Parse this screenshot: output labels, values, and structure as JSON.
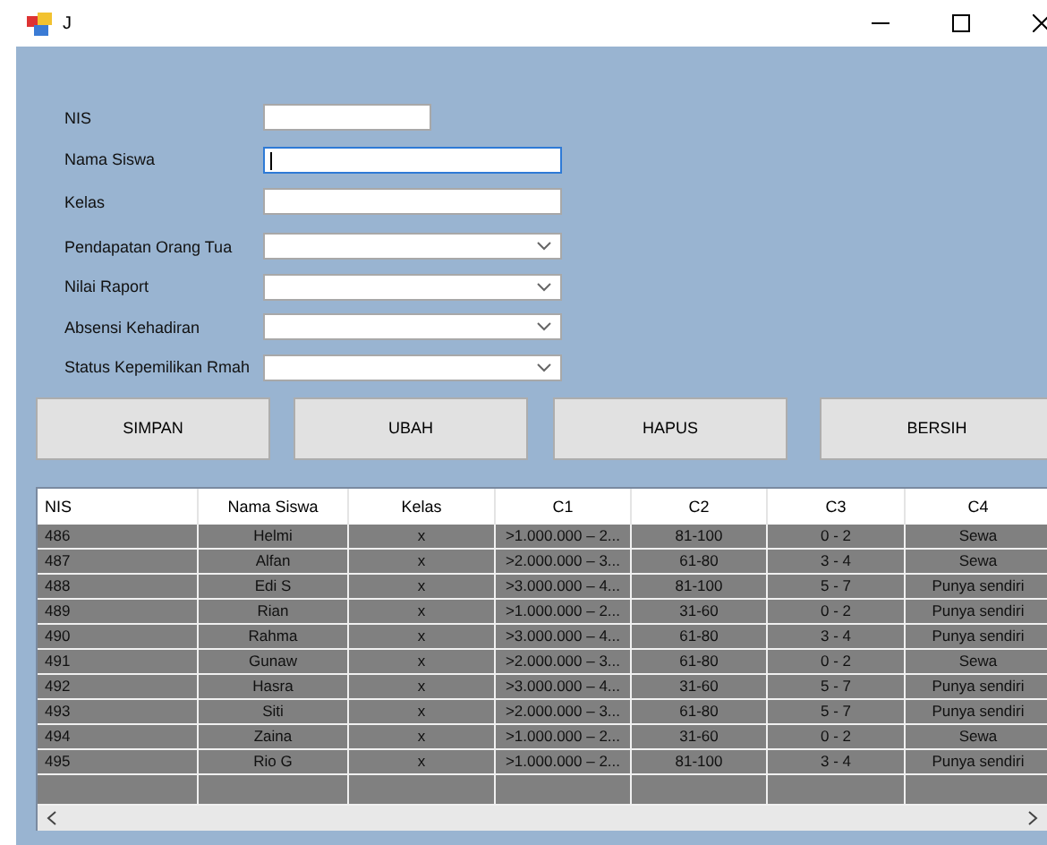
{
  "window": {
    "title": "J"
  },
  "fields": [
    {
      "label": "NIS",
      "kind": "text",
      "focused": false
    },
    {
      "label": "Nama Siswa",
      "kind": "text",
      "focused": true
    },
    {
      "label": "Kelas",
      "kind": "text",
      "focused": false
    },
    {
      "label": "Pendapatan Orang Tua",
      "kind": "combo",
      "focused": false
    },
    {
      "label": "Nilai Raport",
      "kind": "combo",
      "focused": false
    },
    {
      "label": "Absensi Kehadiran",
      "kind": "combo",
      "focused": false
    },
    {
      "label": "Status Kepemilikan Rmah",
      "kind": "combo",
      "focused": false
    }
  ],
  "buttons": [
    "SIMPAN",
    "UBAH",
    "HAPUS",
    "BERSIH"
  ],
  "table": {
    "columns": [
      "NIS",
      "Nama Siswa",
      "Kelas",
      "C1",
      "C2",
      "C3",
      "C4"
    ],
    "rows": [
      [
        "486",
        "Helmi",
        "x",
        ">1.000.000 – 2...",
        "81-100",
        "0 - 2",
        "Sewa"
      ],
      [
        "487",
        "Alfan",
        "x",
        ">2.000.000 – 3...",
        "61-80",
        "3 - 4",
        "Sewa"
      ],
      [
        "488",
        "Edi S",
        "x",
        ">3.000.000 – 4...",
        "81-100",
        "5 - 7",
        "Punya sendiri"
      ],
      [
        "489",
        "Rian",
        "x",
        ">1.000.000 – 2...",
        "31-60",
        "0 - 2",
        "Punya sendiri"
      ],
      [
        "490",
        "Rahma",
        "x",
        ">3.000.000 – 4...",
        "61-80",
        "3 - 4",
        "Punya sendiri"
      ],
      [
        "491",
        "Gunaw",
        "x",
        ">2.000.000 – 3...",
        "61-80",
        "0 - 2",
        "Sewa"
      ],
      [
        "492",
        "Hasra",
        "x",
        ">3.000.000 – 4...",
        "31-60",
        "5 - 7",
        "Punya sendiri"
      ],
      [
        "493",
        "Siti",
        "x",
        ">2.000.000 – 3...",
        "61-80",
        "5 - 7",
        "Punya sendiri"
      ],
      [
        "494",
        "Zaina",
        "x",
        ">1.000.000 – 2...",
        "31-60",
        "0 - 2",
        "Sewa"
      ],
      [
        "495",
        "Rio G",
        "x",
        ">1.000.000 – 2...",
        "81-100",
        "3 - 4",
        "Punya sendiri"
      ]
    ]
  }
}
